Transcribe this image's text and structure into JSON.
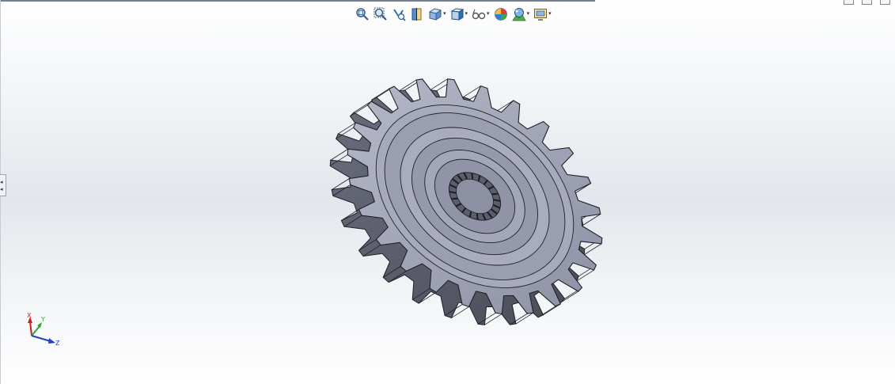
{
  "toolbar": {
    "items": [
      {
        "name": "zoom-to-fit-icon",
        "dropdown": false
      },
      {
        "name": "zoom-to-area-icon",
        "dropdown": false
      },
      {
        "name": "previous-view-icon",
        "dropdown": false
      },
      {
        "name": "section-view-icon",
        "dropdown": false
      },
      {
        "name": "view-orientation-icon",
        "dropdown": true
      },
      {
        "name": "display-style-icon",
        "dropdown": true
      },
      {
        "name": "hide-show-items-icon",
        "dropdown": true
      },
      {
        "name": "edit-appearance-icon",
        "dropdown": false
      },
      {
        "name": "apply-scene-icon",
        "dropdown": true
      },
      {
        "name": "view-settings-icon",
        "dropdown": true
      }
    ],
    "dropdown_glyph": "▾"
  },
  "panel_handle": {
    "glyph_top": "◂",
    "glyph_bottom": "◂"
  },
  "triad": {
    "x_label": "X",
    "y_label": "Y",
    "z_label": "Z"
  },
  "model": {
    "name": "spur gear with splined bore",
    "tooth_count": 24,
    "colors": {
      "face": "#9ea2b4",
      "shadow": "#5b5e6c",
      "edge": "#202028"
    }
  },
  "colors": {
    "axis_x": "#cc1f1f",
    "axis_y": "#2aa52a",
    "axis_z": "#1f3fcc",
    "toolbar_accent": "#2a6fb8"
  }
}
